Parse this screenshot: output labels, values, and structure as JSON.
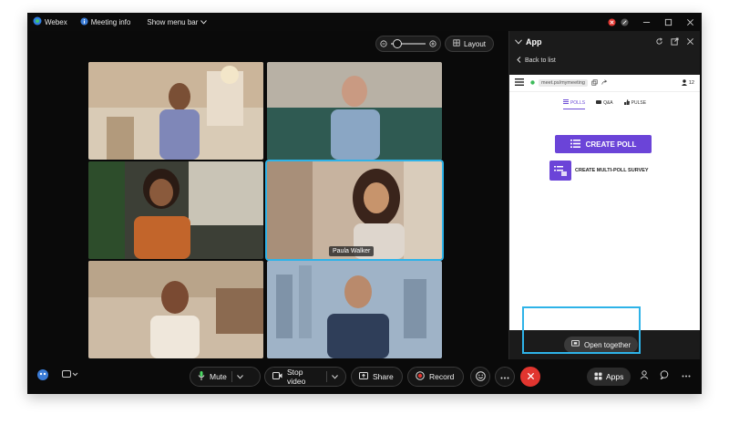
{
  "titlebar": {
    "app_name": "Webex",
    "meeting_info": "Meeting info",
    "menu_bar": "Show menu bar"
  },
  "layout_button": {
    "label": "Layout"
  },
  "participants": [
    {
      "name": "",
      "active": false
    },
    {
      "name": "",
      "active": false
    },
    {
      "name": "",
      "active": false
    },
    {
      "name": "Paula Walker",
      "active": true
    },
    {
      "name": "",
      "active": false
    },
    {
      "name": "",
      "active": false
    }
  ],
  "panel": {
    "title": "App",
    "back": "Back to list",
    "url": "meet.ps/mymeeting",
    "participant_count": "12",
    "tabs": [
      "POLLS",
      "Q&A",
      "PULSE"
    ],
    "create_poll": "CREATE POLL",
    "survey": "CREATE MULTI-POLL SURVEY",
    "open_together": "Open together"
  },
  "toolbar": {
    "mute": "Mute",
    "stop_video": "Stop video",
    "share": "Share",
    "record": "Record",
    "apps": "Apps"
  },
  "colors": {
    "accent": "#2eb3e8",
    "brand_purple": "#6b44d8",
    "end_call": "#e1352f"
  }
}
